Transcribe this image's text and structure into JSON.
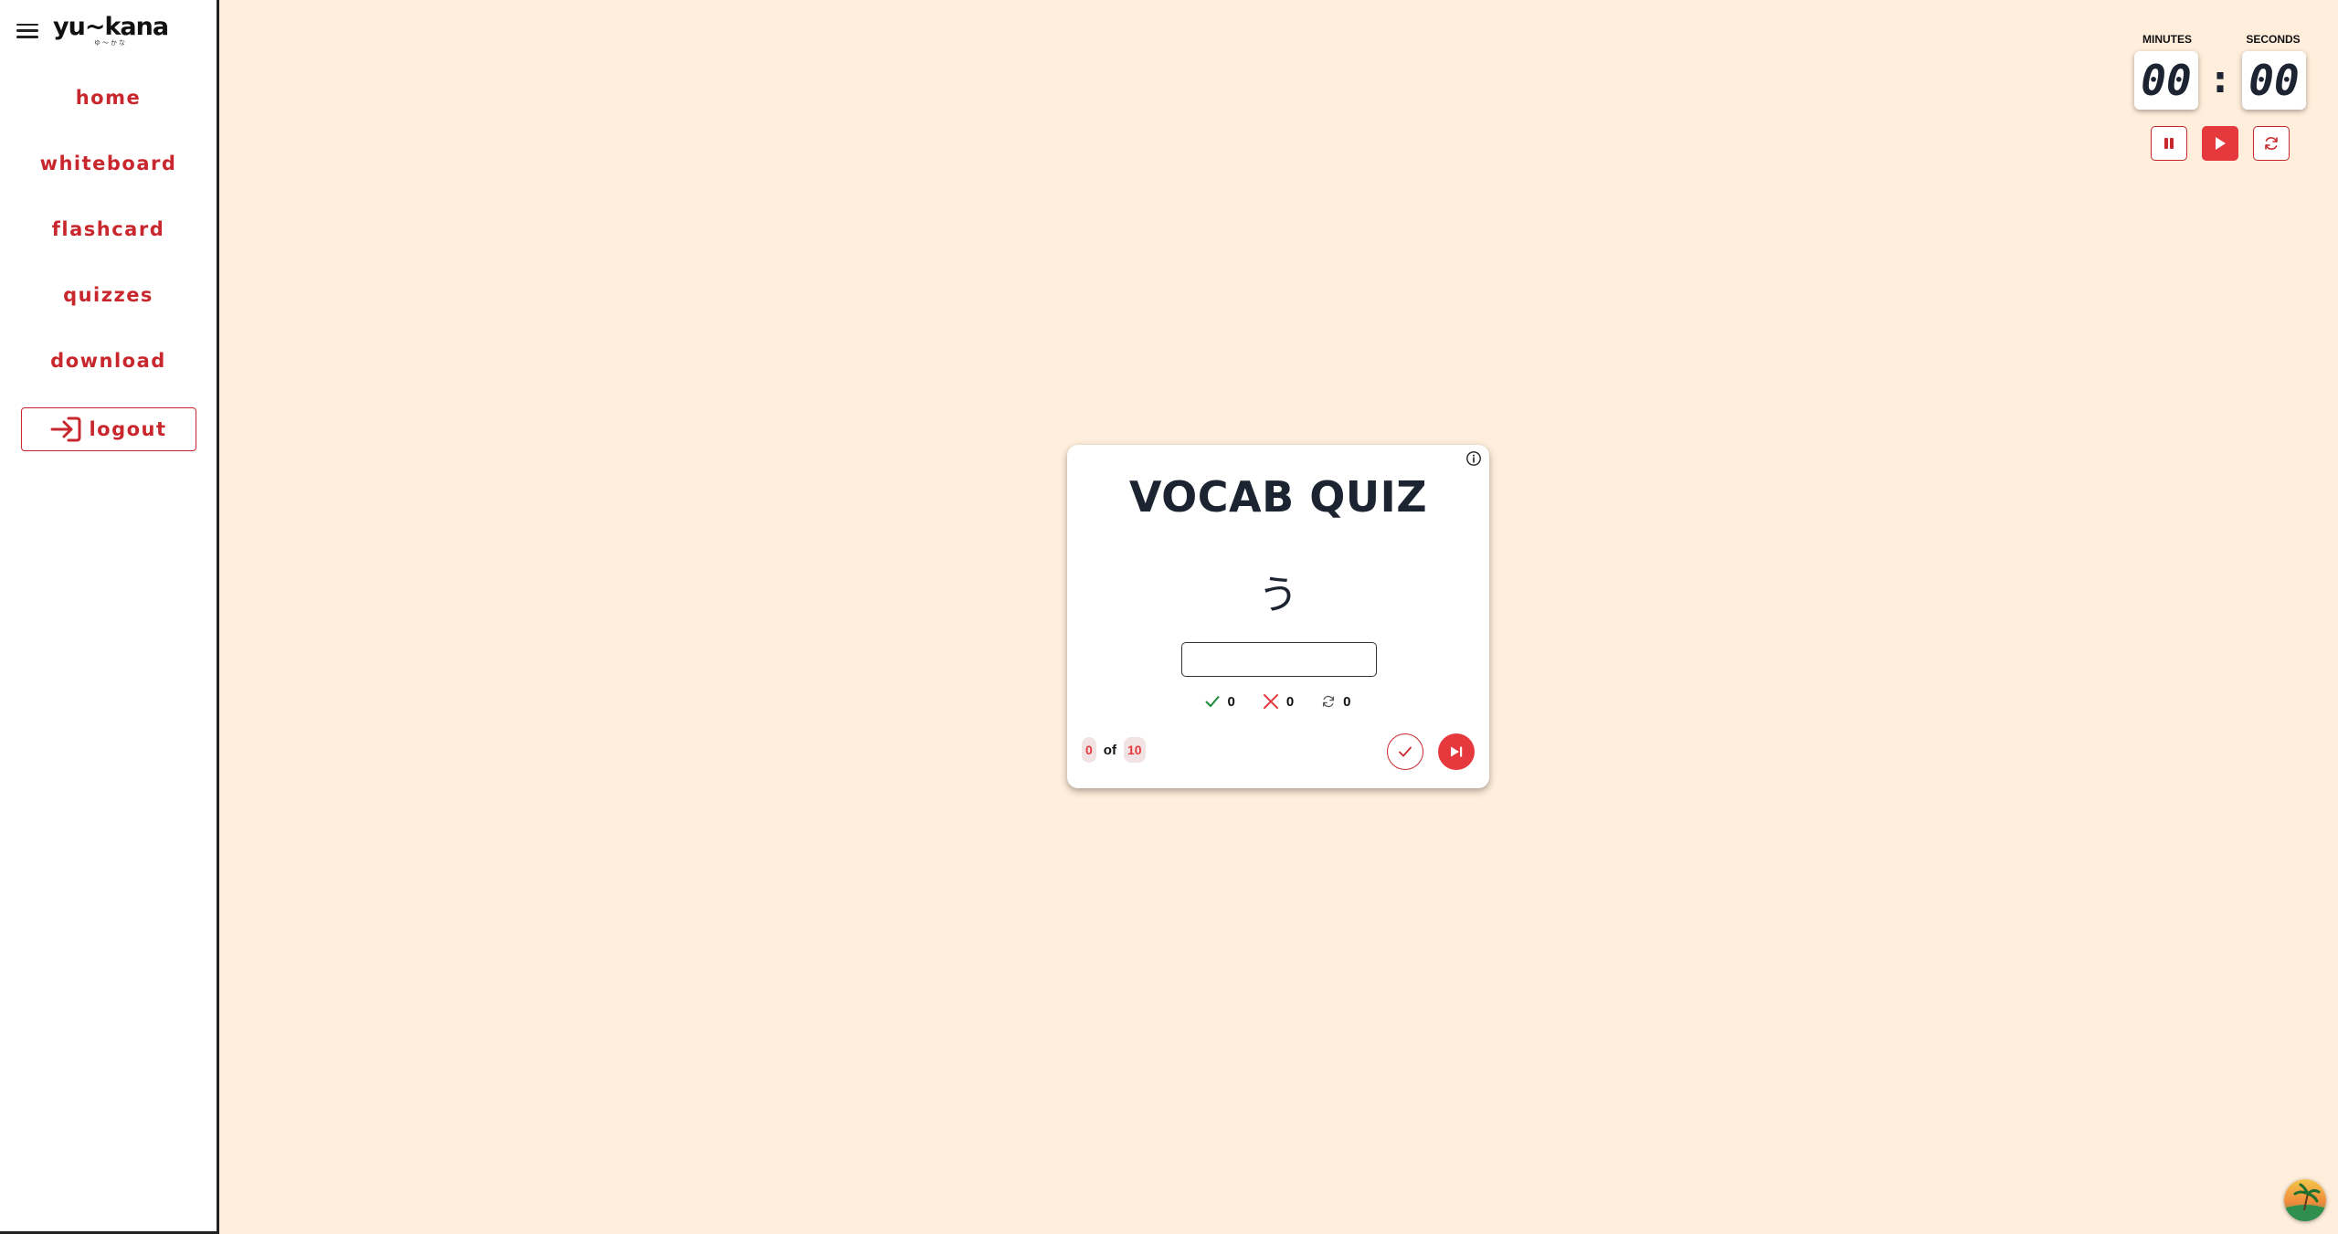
{
  "app": {
    "logo_text": "yu~kana",
    "logo_subtext": "ゆ〜かな"
  },
  "sidebar": {
    "items": [
      {
        "label": "home"
      },
      {
        "label": "whiteboard"
      },
      {
        "label": "flashcard"
      },
      {
        "label": "quizzes"
      },
      {
        "label": "download"
      }
    ],
    "logout_label": "logout"
  },
  "timer": {
    "minutes_label": "MINUTES",
    "seconds_label": "SECONDS",
    "minutes": "00",
    "seconds": "00",
    "separator": ":"
  },
  "quiz": {
    "title": "VOCAB QUIZ",
    "prompt": "う",
    "answer_value": "",
    "answer_placeholder": "",
    "stats": {
      "correct": "0",
      "wrong": "0",
      "skipped": "0"
    },
    "progress": {
      "current": "0",
      "of_label": "of",
      "total": "10"
    }
  },
  "colors": {
    "accent": "#e6393e",
    "nav_text": "#c8282d",
    "background": "#ffeedb",
    "correct": "#1a8a3a"
  }
}
